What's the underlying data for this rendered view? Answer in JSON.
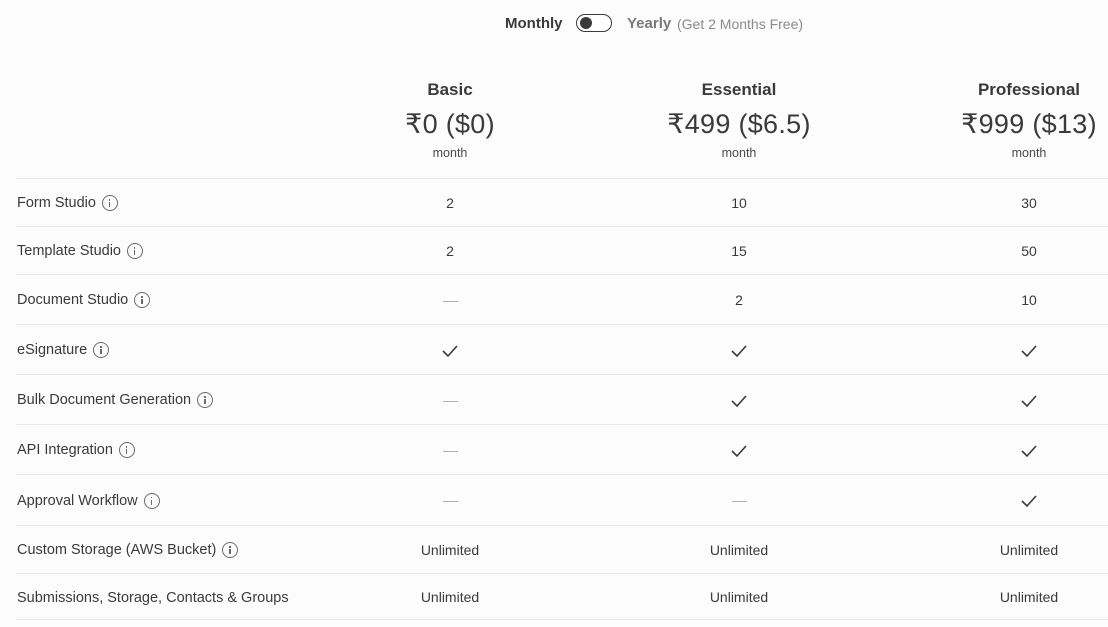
{
  "billing_toggle": {
    "monthly_label": "Monthly",
    "yearly_label": "Yearly",
    "yearly_note": "(Get 2 Months Free)",
    "selected": "Monthly"
  },
  "plans": [
    {
      "name": "Basic",
      "price": "₹0 ($0)",
      "period": "month"
    },
    {
      "name": "Essential",
      "price": "₹499 ($6.5)",
      "period": "month"
    },
    {
      "name": "Professional",
      "price": "₹999 ($13)",
      "period": "month"
    }
  ],
  "features": [
    {
      "label": "Form Studio",
      "info": true,
      "values": [
        "2",
        "10",
        "30"
      ]
    },
    {
      "label": "Template Studio",
      "info": true,
      "values": [
        "2",
        "15",
        "50"
      ]
    },
    {
      "label": "Document Studio",
      "info": true,
      "values": [
        "dash",
        "2",
        "10"
      ]
    },
    {
      "label": "eSignature",
      "info": true,
      "values": [
        "check",
        "check",
        "check"
      ]
    },
    {
      "label": "Bulk Document Generation",
      "info": true,
      "values": [
        "dash",
        "check",
        "check"
      ]
    },
    {
      "label": "API Integration",
      "info": true,
      "values": [
        "dash",
        "check",
        "check"
      ]
    },
    {
      "label": "Approval Workflow",
      "info": true,
      "values": [
        "dash",
        "dash",
        "check"
      ]
    },
    {
      "label": "Custom Storage (AWS Bucket)",
      "info": true,
      "values": [
        "Unlimited",
        "Unlimited",
        "Unlimited"
      ]
    },
    {
      "label": "Submissions, Storage, Contacts & Groups",
      "info": false,
      "values": [
        "Unlimited",
        "Unlimited",
        "Unlimited"
      ]
    }
  ],
  "icons": {
    "info": "info-circle-icon",
    "check": "checkmark-icon",
    "dash": "dash-icon"
  },
  "colors": {
    "background": "#fcfcfc",
    "text": "#3a3a3a",
    "muted": "#8a8a8a",
    "divider": "#e9e9e9"
  }
}
